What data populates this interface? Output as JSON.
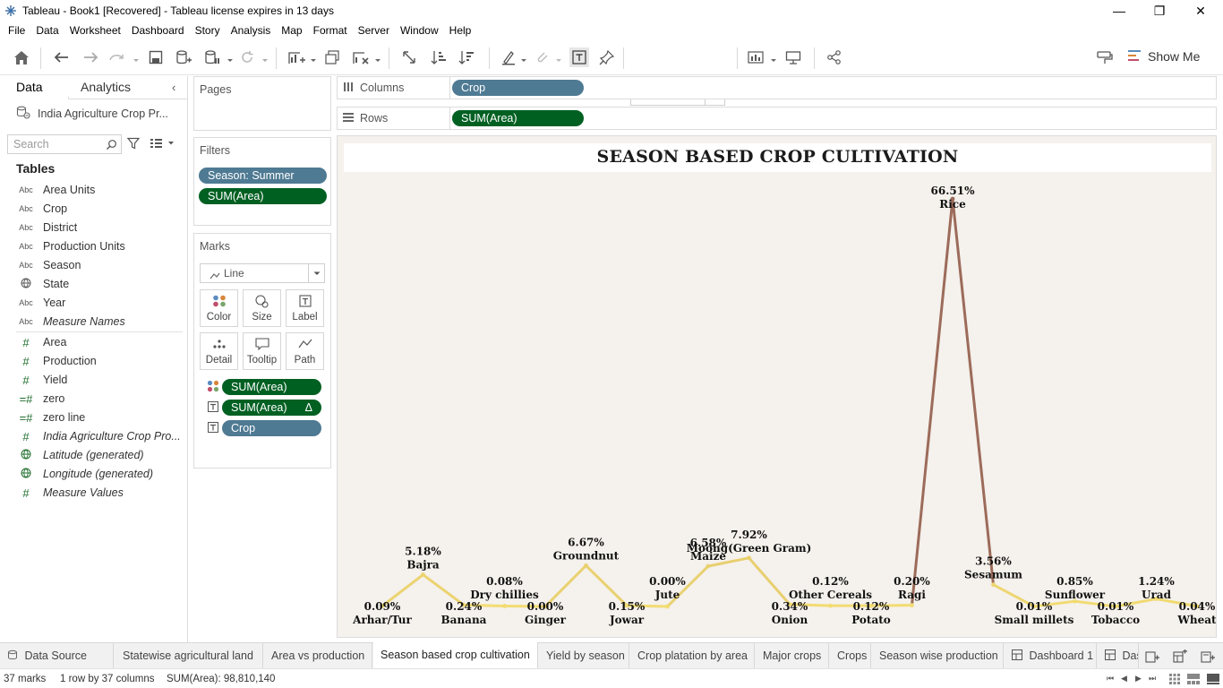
{
  "window": {
    "title": "Tableau - Book1 [Recovered] - Tableau license expires in 13 days",
    "minimize": "—",
    "maximize": "❐",
    "close": "✕"
  },
  "menu": [
    "File",
    "Data",
    "Worksheet",
    "Dashboard",
    "Story",
    "Analysis",
    "Map",
    "Format",
    "Server",
    "Window",
    "Help"
  ],
  "toolbar": {
    "fit": "Fit Width",
    "show_me": "Show Me"
  },
  "data_pane": {
    "tab_data": "Data",
    "tab_analytics": "Analytics",
    "data_source": "India Agriculture Crop Pr...",
    "search_placeholder": "Search",
    "tables_heading": "Tables",
    "dimensions": [
      {
        "icon": "Abc",
        "name": "Area Units",
        "italic": false
      },
      {
        "icon": "Abc",
        "name": "Crop",
        "italic": false
      },
      {
        "icon": "Abc",
        "name": "District",
        "italic": false
      },
      {
        "icon": "Abc",
        "name": "Production Units",
        "italic": false
      },
      {
        "icon": "Abc",
        "name": "Season",
        "italic": false
      },
      {
        "icon": "globe",
        "name": "State",
        "italic": false
      },
      {
        "icon": "Abc",
        "name": "Year",
        "italic": false
      },
      {
        "icon": "Abc",
        "name": "Measure Names",
        "italic": true
      }
    ],
    "measures": [
      {
        "icon": "#",
        "name": "Area",
        "italic": false
      },
      {
        "icon": "#",
        "name": "Production",
        "italic": false
      },
      {
        "icon": "#",
        "name": "Yield",
        "italic": false
      },
      {
        "icon": "=#",
        "name": "zero",
        "italic": false
      },
      {
        "icon": "=#",
        "name": "zero line",
        "italic": false
      },
      {
        "icon": "#",
        "name": "India Agriculture Crop Pro...",
        "italic": true
      },
      {
        "icon": "globe",
        "name": "Latitude (generated)",
        "italic": true
      },
      {
        "icon": "globe",
        "name": "Longitude (generated)",
        "italic": true
      },
      {
        "icon": "#",
        "name": "Measure Values",
        "italic": true
      }
    ]
  },
  "pages": {
    "title": "Pages"
  },
  "filters": {
    "title": "Filters",
    "items": [
      "Season: Summer",
      "SUM(Area)"
    ]
  },
  "marks": {
    "title": "Marks",
    "type": "Line",
    "buttons": [
      "Color",
      "Size",
      "Label",
      "Detail",
      "Tooltip",
      "Path"
    ],
    "pills": [
      "SUM(Area)",
      "SUM(Area)",
      "Crop"
    ],
    "delta": "Δ"
  },
  "shelves": {
    "columns_label": "Columns",
    "columns_pill": "Crop",
    "rows_label": "Rows",
    "rows_pill": "SUM(Area)"
  },
  "chart_data": {
    "type": "line",
    "title": "SEASON BASED CROP CULTIVATION",
    "x": [
      "Arhar/Tur",
      "Bajra",
      "Banana",
      "Dry chillies",
      "Ginger",
      "Groundnut",
      "Jowar",
      "Jute",
      "Maize",
      "Moong(Green Gram)",
      "Onion",
      "Other Cereals",
      "Potato",
      "Ragi",
      "Rice",
      "Sesamum",
      "Small millets",
      "Sunflower",
      "Tobacco",
      "Urad",
      "Wheat"
    ],
    "series": [
      {
        "values": [
          0.09,
          5.18,
          0.24,
          0.08,
          0.0,
          6.67,
          0.15,
          0.0,
          6.58,
          7.92,
          0.34,
          0.12,
          0.12,
          0.2,
          66.51,
          3.56,
          0.01,
          0.85,
          0.01,
          1.24,
          0.04
        ]
      }
    ],
    "labels": [
      "0.09%",
      "5.18%",
      "0.24%",
      "0.08%",
      "0.00%",
      "6.67%",
      "0.15%",
      "0.00%",
      "6.58%",
      "7.92%",
      "0.34%",
      "0.12%",
      "0.12%",
      "0.20%",
      "66.51%",
      "3.56%",
      "0.01%",
      "0.85%",
      "0.01%",
      "1.24%",
      "0.04%"
    ],
    "unit": "percent of total SUM(Area)",
    "color_low": "#f2dc72",
    "color_high": "#9c6b5a"
  },
  "sheet_tabs": {
    "data_source": "Data Source",
    "sheets": [
      "Statewise agricultural land",
      "Area vs production",
      "Season based crop cultivation",
      "Yield by season",
      "Crop platation by area",
      "Major crops",
      "Crops",
      "Season wise production",
      "Dashboard 1",
      "Das"
    ],
    "active": "Season based crop cultivation"
  },
  "status": {
    "marks": "37 marks",
    "dims": "1 row by 37 columns",
    "sum": "SUM(Area): 98,810,140"
  }
}
